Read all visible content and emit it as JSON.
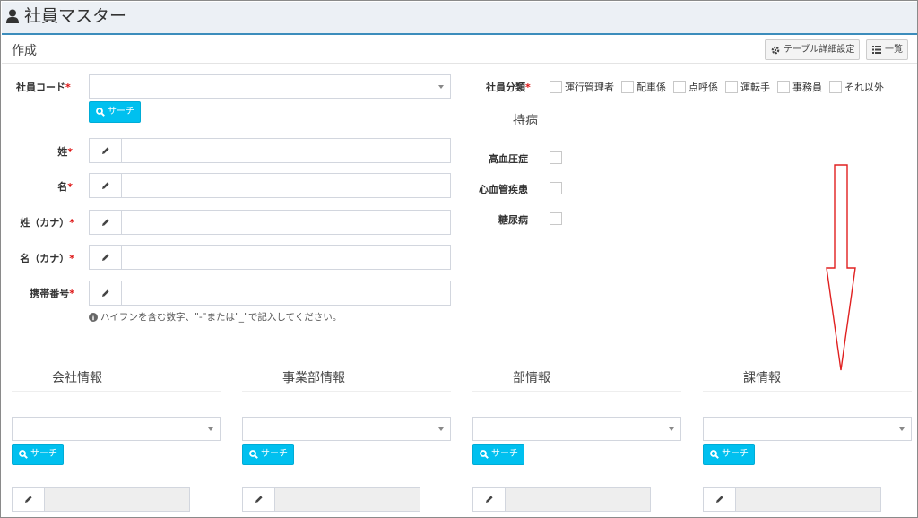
{
  "header": {
    "title": "社員マスター",
    "icon": "user-icon"
  },
  "panel": {
    "title": "作成",
    "table_settings_label": "テーブル詳細設定",
    "list_label": "一覧"
  },
  "form": {
    "required_mark": "*",
    "employee_code": {
      "label": "社員コード",
      "search_label": "サーチ"
    },
    "last_name": {
      "label": "姓"
    },
    "first_name": {
      "label": "名"
    },
    "last_name_kana": {
      "label": "姓（カナ）"
    },
    "first_name_kana": {
      "label": "名（カナ）"
    },
    "mobile": {
      "label": "携帯番号",
      "hint": "ハイフンを含む数字、\"-\"または\"_\"で記入してください。"
    }
  },
  "employee_type": {
    "label": "社員分類",
    "options": [
      "運行管理者",
      "配車係",
      "点呼係",
      "運転手",
      "事務員",
      "それ以外"
    ]
  },
  "illness": {
    "title": "持病",
    "items": [
      "高血圧症",
      "心血管疾患",
      "糖尿病"
    ]
  },
  "sections": [
    {
      "title": "会社情報",
      "search_label": "サーチ"
    },
    {
      "title": "事業部情報",
      "search_label": "サーチ"
    },
    {
      "title": "部情報",
      "search_label": "サーチ"
    },
    {
      "title": "課情報",
      "search_label": "サーチ"
    }
  ],
  "colors": {
    "accent": "#3c8dbc",
    "info_button": "#00c0ef",
    "required": "#dd1111",
    "annotation_arrow": "#e02020"
  }
}
